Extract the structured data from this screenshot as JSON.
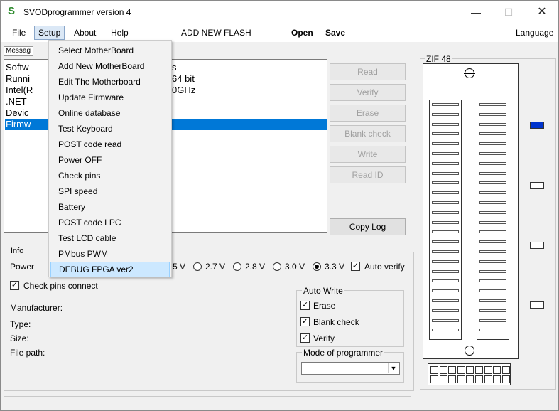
{
  "window": {
    "title": "SVODprogrammer version 4",
    "minimize_icon": "minimize-icon",
    "maximize_icon": "maximize-icon",
    "close_icon": "close-icon"
  },
  "menubar": {
    "file": "File",
    "setup": "Setup",
    "about": "About",
    "help": "Help",
    "add_new_flash": "ADD NEW FLASH",
    "open": "Open",
    "save": "Save",
    "language": "Language"
  },
  "setup_menu": [
    "Select MotherBoard",
    "Add New MotherBoard",
    "Edit The Motherboard",
    "Update Firmware",
    "Online database",
    "Test Keyboard",
    "POST code read",
    "Power OFF",
    "Check pins",
    "SPI speed",
    "Battery",
    "POST code LPC",
    "Test LCD cable",
    "PMbus PWM",
    "DEBUG FPGA ver2"
  ],
  "messages": {
    "tab_label": "Messag",
    "lines": [
      "Softw",
      "Runni",
      "Intel(R",
      ".NET",
      "Devic",
      "Firmw"
    ],
    "line_tails": [
      "s",
      " 64 bit",
      "0GHz",
      "",
      "",
      ""
    ]
  },
  "buttons": {
    "read": "Read",
    "verify": "Verify",
    "erase": "Erase",
    "blank_check": "Blank check",
    "write": "Write",
    "read_id": "Read ID",
    "copy_log": "Copy Log"
  },
  "info": {
    "group_label": "Info",
    "power_label": "Power",
    "voltages": [
      "5 V",
      "2.7 V",
      "2.8 V",
      "3.0 V",
      "3.3 V"
    ],
    "selected_voltage": "3.3 V",
    "auto_verify": "Auto verify",
    "check_pins_connect": "Check pins connect",
    "manufacturer": "Manufacturer:",
    "type": "Type:",
    "size": "Size:",
    "file_path": "File path:"
  },
  "auto_write": {
    "label": "Auto Write",
    "erase": "Erase",
    "blank_check": "Blank check",
    "verify": "Verify"
  },
  "mode": {
    "label": "Mode of programmer",
    "value": ""
  },
  "zif": {
    "label": "ZIF 48",
    "pins_per_side": 24,
    "active_indicator_color": "#0033cc"
  },
  "colors": {
    "selection": "#0078d7",
    "menu_highlight": "#cce8ff",
    "disabled_text": "#a0a0a0"
  }
}
